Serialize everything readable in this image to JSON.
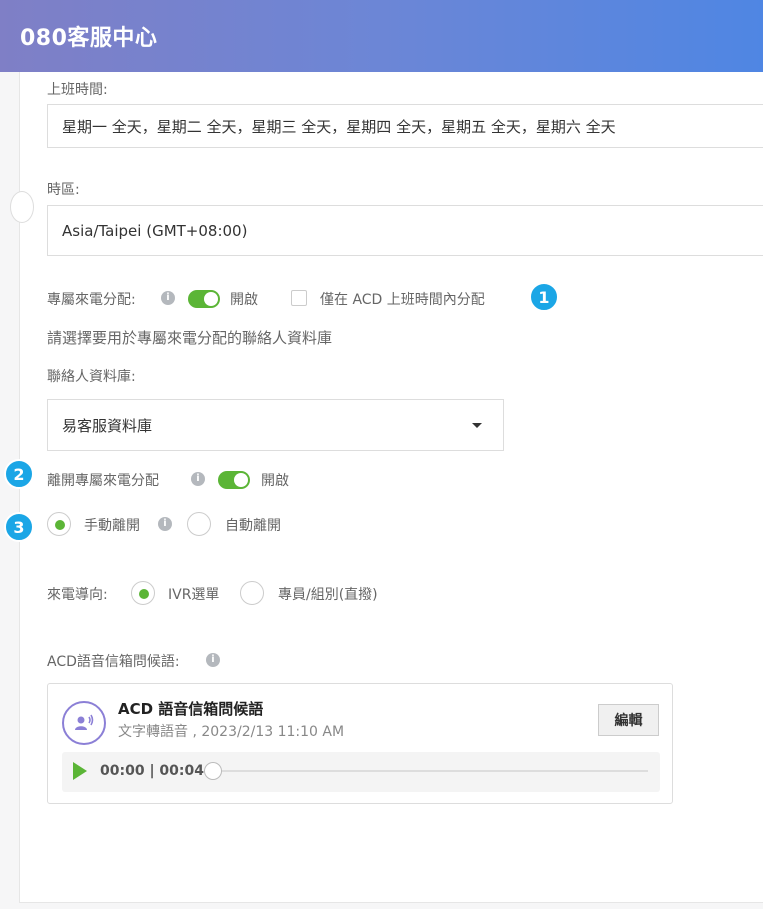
{
  "app": {
    "title": "080客服中心"
  },
  "form": {
    "work_hours_label": "上班時間:",
    "work_hours_value": "星期一  全天，星期二  全天，星期三  全天，星期四  全天，星期五  全天，星期六  全天",
    "timezone_label": "時區:",
    "timezone_value": "Asia/Taipei (GMT+08:00)",
    "exclusive_label": "專屬來電分配:",
    "exclusive_toggle_label": "開啟",
    "acd_only_label": "僅在 ACD 上班時間內分配",
    "contact_db_hint": "請選擇要用於專屬來電分配的聯絡人資料庫",
    "contact_db_label": "聯絡人資料庫:",
    "contact_db_value": "易客服資料庫",
    "leave_label": "離開專屬來電分配",
    "leave_toggle_label": "開啟",
    "manual_leave_label": "手動離開",
    "auto_leave_label": "自動離開",
    "routing_label": "來電導向:",
    "routing_ivr_label": "IVR選單",
    "routing_direct_label": "專員/組別(直撥)",
    "acd_greeting_label": "ACD語音信箱問候語:"
  },
  "badges": {
    "one": "1",
    "two": "2",
    "three": "3"
  },
  "audio": {
    "title": "ACD 語音信箱問候語",
    "subtitle": "文字轉語音 , 2023/2/13 11:10 AM",
    "edit_label": "編輯",
    "time": "00:00 | 00:04",
    "progress": 0
  },
  "colors": {
    "accent_green": "#5bb536",
    "badge_blue": "#1ba6e6",
    "header_start": "#7f7fc6",
    "header_end": "#4f86e3"
  },
  "icons": {
    "info": "info-icon",
    "voice": "voice-user-icon",
    "play": "play-icon",
    "caret": "caret-down-icon"
  }
}
